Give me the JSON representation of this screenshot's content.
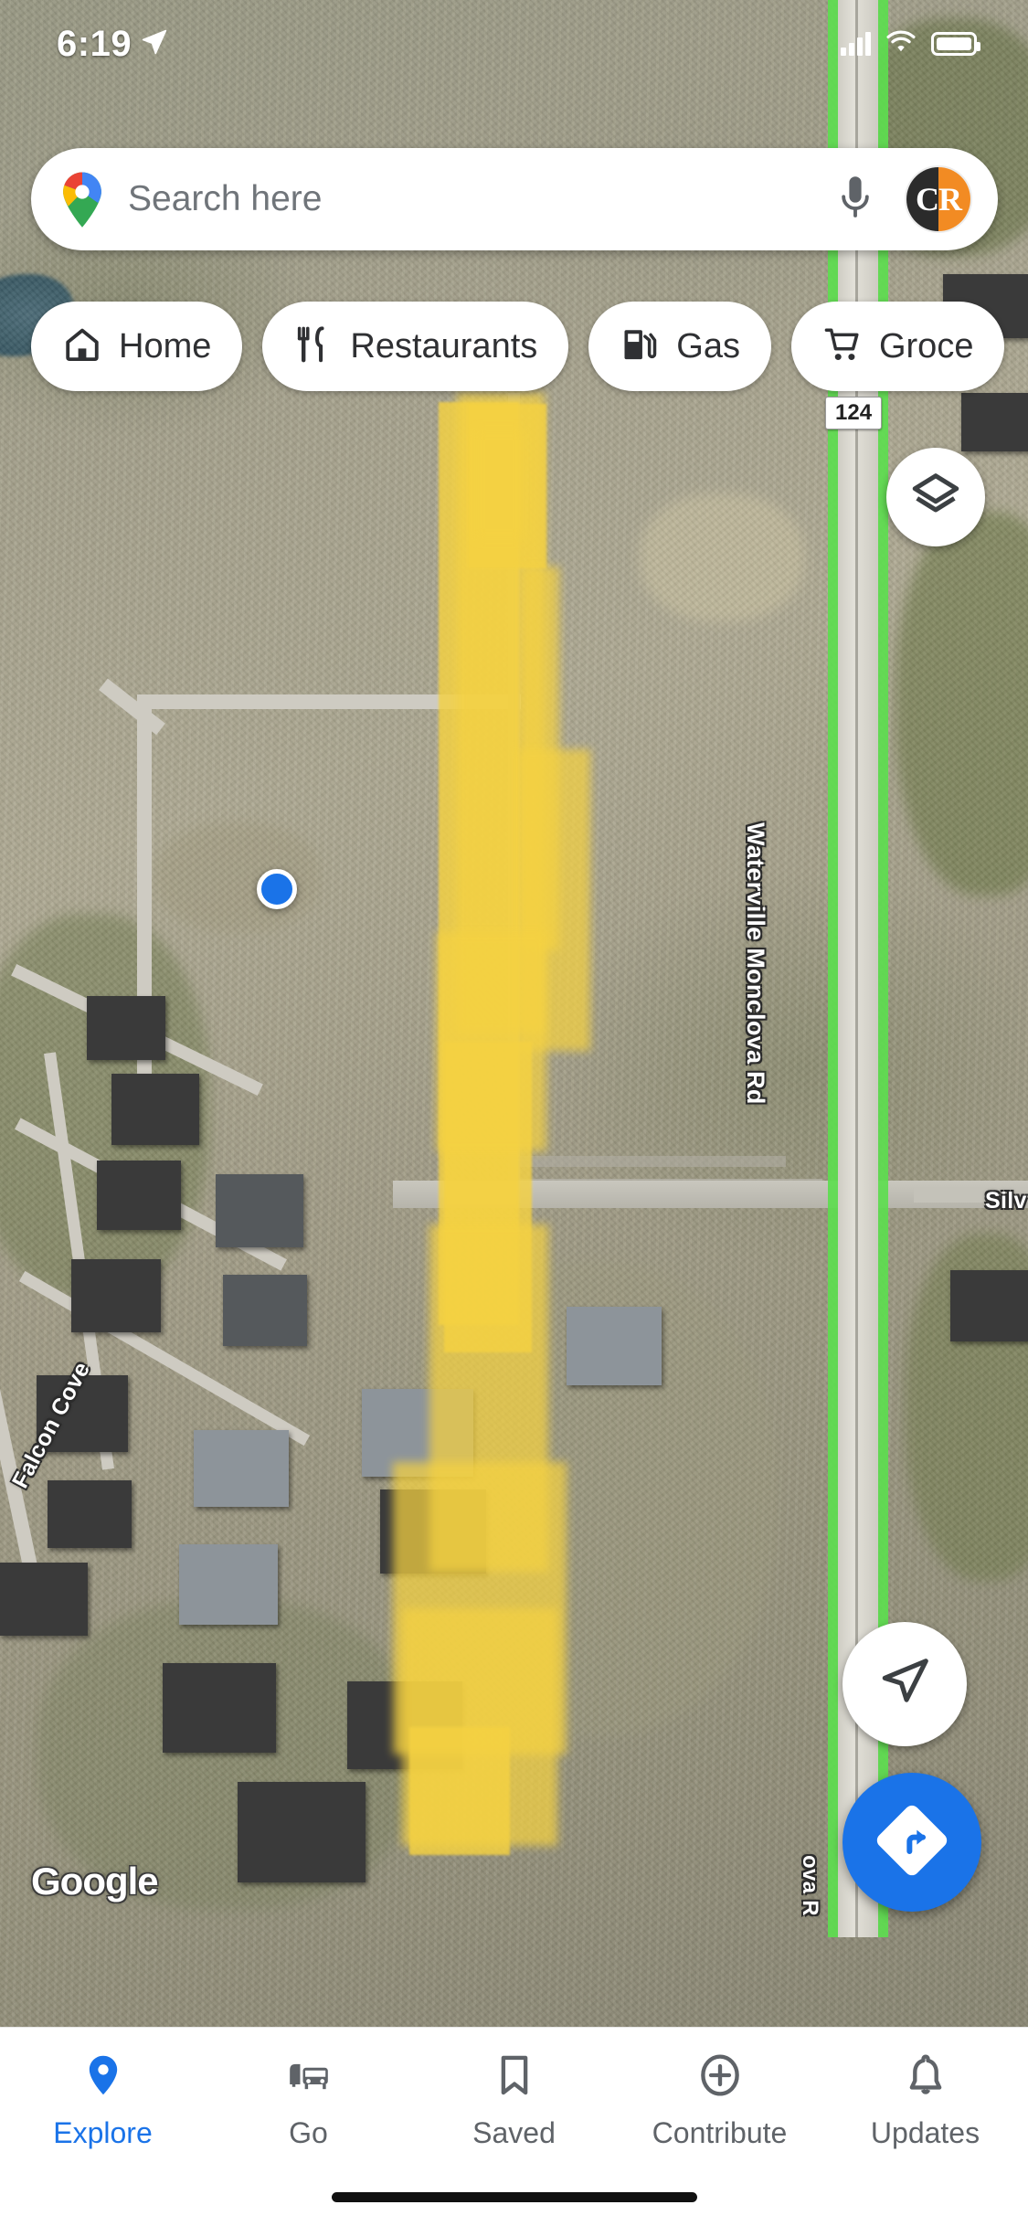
{
  "status_bar": {
    "time": "6:19",
    "location_arrow_icon": "location-arrow-icon",
    "signal_icon": "signal-bars-icon",
    "wifi_icon": "wifi-icon",
    "battery_icon": "battery-full-icon"
  },
  "search": {
    "placeholder": "Search here",
    "logo_icon": "google-maps-pin-icon",
    "mic_icon": "microphone-icon",
    "avatar_initials": "CR"
  },
  "chips": [
    {
      "label": "Home",
      "icon": "home-icon"
    },
    {
      "label": "Restaurants",
      "icon": "restaurant-icon"
    },
    {
      "label": "Gas",
      "icon": "gas-pump-icon"
    },
    {
      "label": "Groce",
      "icon": "shopping-cart-icon"
    }
  ],
  "map_controls": {
    "layers_icon": "layers-icon",
    "my_location_icon": "navigation-arrow-icon",
    "directions_icon": "directions-turn-icon"
  },
  "map": {
    "attribution": "Google",
    "route_shield": "124",
    "labels": [
      {
        "text": "Waterville Monclova Rd",
        "orientation": "vertical"
      },
      {
        "text": "Falcon Cove",
        "orientation": "diagonal"
      },
      {
        "text": "Silv",
        "orientation": "horizontal"
      },
      {
        "text": "ova R",
        "orientation": "vertical"
      }
    ],
    "user_location_marker": "blue-location-dot",
    "annotation": "yellow-highlighter-stroke",
    "view_type": "satellite"
  },
  "bottom_nav": [
    {
      "label": "Explore",
      "icon": "map-pin-icon",
      "active": true
    },
    {
      "label": "Go",
      "icon": "transit-icon",
      "active": false
    },
    {
      "label": "Saved",
      "icon": "bookmark-icon",
      "active": false
    },
    {
      "label": "Contribute",
      "icon": "plus-circle-icon",
      "active": false
    },
    {
      "label": "Updates",
      "icon": "bell-icon",
      "active": false
    }
  ],
  "colors": {
    "accent": "#1a73e8",
    "highlight": "#f5d242",
    "route_green": "#5ddd4f",
    "chip_text": "#2f3033",
    "nav_inactive": "#5f6368"
  }
}
